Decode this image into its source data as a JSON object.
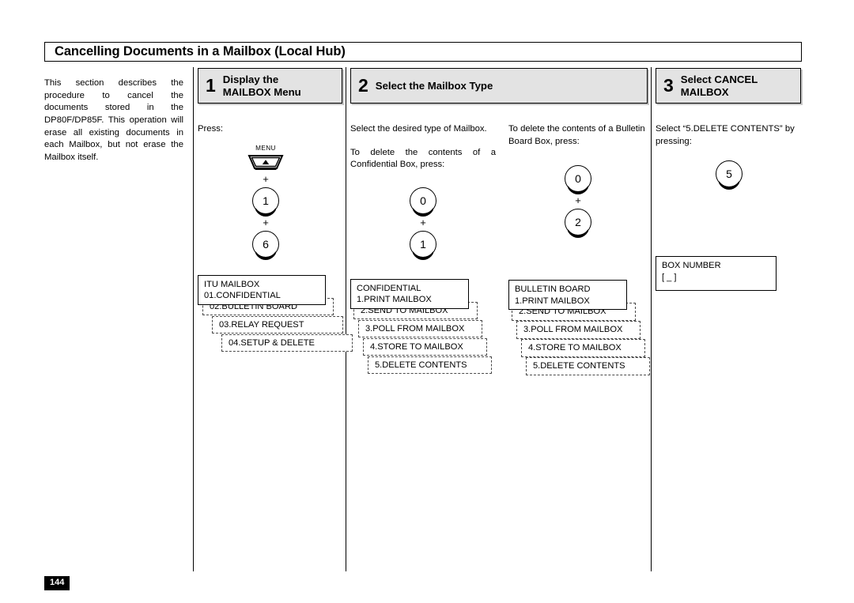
{
  "document": {
    "title": "Cancelling Documents in a Mailbox (Local Hub)",
    "page_number": "144"
  },
  "intro": {
    "text": "This section describes the procedure to cancel the documents stored in the DP80F/DP85F. This operation will erase all existing documents in each Mailbox, but not erase the Mailbox itself."
  },
  "steps": [
    {
      "number": "1",
      "label": "Display the\nMAILBOX Menu"
    },
    {
      "number": "2",
      "label": "Select the Mailbox Type"
    },
    {
      "number": "3",
      "label": "Select CANCEL\nMAILBOX"
    }
  ],
  "column1": {
    "press_label": "Press:",
    "menu_key_caption": "MENU",
    "plus": "+",
    "keys": [
      "1",
      "6"
    ],
    "lcd": "ITU MAILBOX\n01.CONFIDENTIAL",
    "menu_rows": [
      "02.BULLETIN BOARD",
      "03.RELAY REQUEST",
      "04.SETUP & DELETE"
    ]
  },
  "column2": {
    "para1": "Select the desired type of Mailbox.",
    "para2": "To delete the contents of a Confidential Box, press:",
    "plus": "+",
    "keys": [
      "0",
      "1"
    ],
    "lcd": "CONFIDENTIAL\n1.PRINT MAILBOX",
    "menu_rows": [
      "2.SEND TO MAILBOX",
      "3.POLL FROM MAILBOX",
      "4.STORE TO MAILBOX",
      "5.DELETE CONTENTS"
    ]
  },
  "column3": {
    "para1": "To delete the contents of a  Bulletin Board Box, press:",
    "plus": "+",
    "keys": [
      "0",
      "2"
    ],
    "lcd": "BULLETIN BOARD\n1.PRINT MAILBOX",
    "menu_rows": [
      "2.SEND TO MAILBOX",
      "3.POLL FROM MAILBOX",
      "4.STORE TO MAILBOX",
      "5.DELETE CONTENTS"
    ]
  },
  "column4": {
    "para1": "Select “5.DELETE CONTENTS” by pressing:",
    "keys": [
      "5"
    ],
    "lcd": "BOX NUMBER\n[ _           ]"
  },
  "colors": {
    "header_fill": "#e3e3e3",
    "line": "#000000",
    "page_badge_bg": "#000000"
  }
}
